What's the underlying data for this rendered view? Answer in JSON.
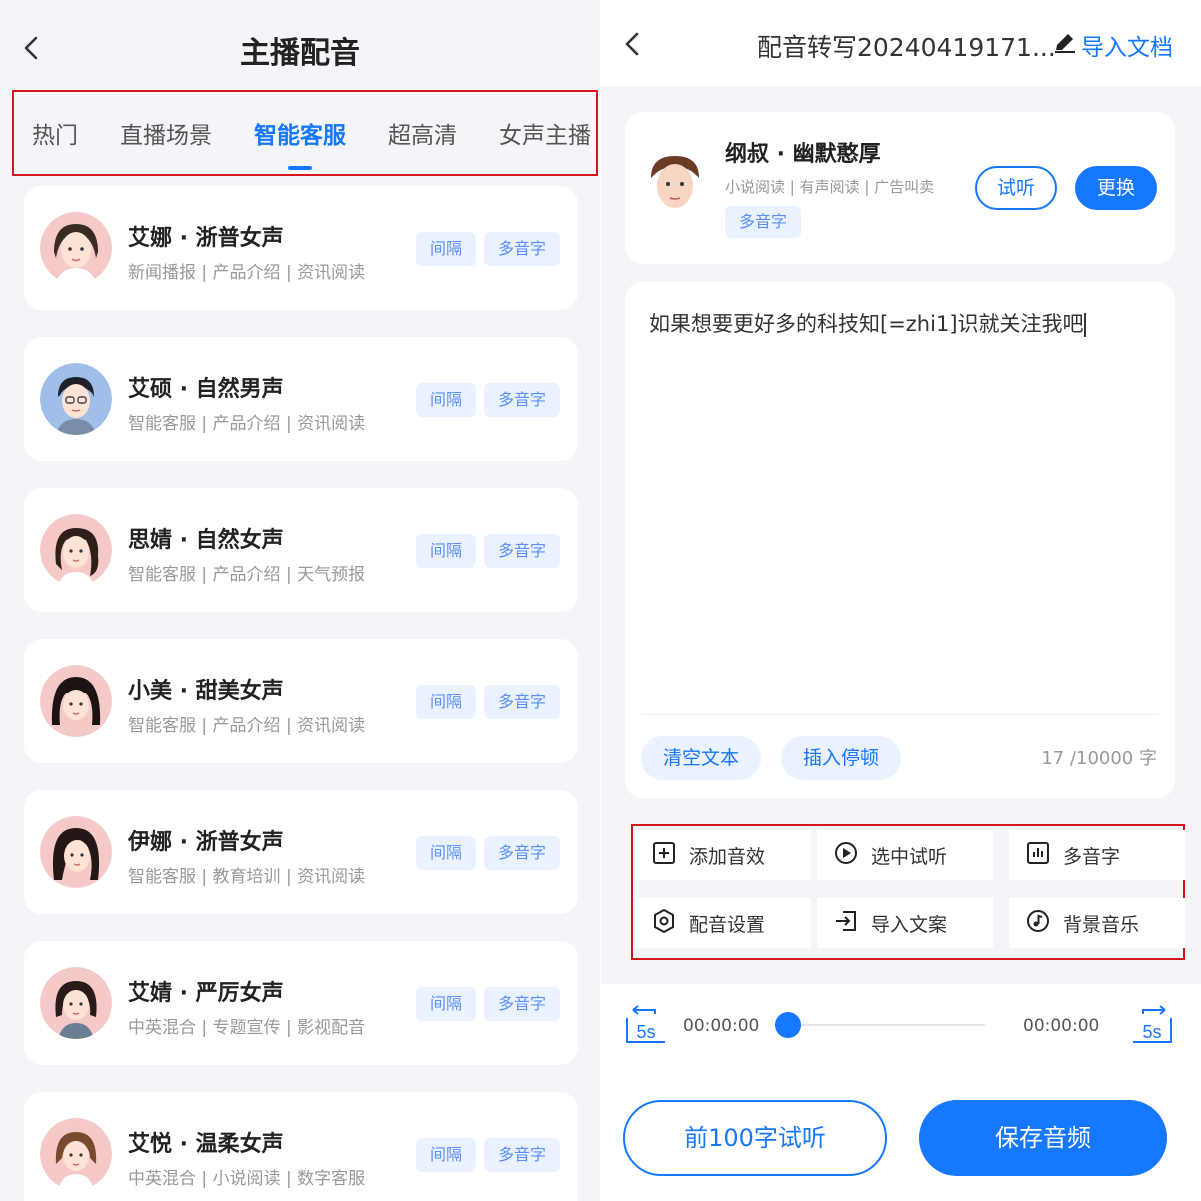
{
  "left": {
    "title": "主播配音",
    "tabs": [
      {
        "label": "热门",
        "active": false
      },
      {
        "label": "直播场景",
        "active": false
      },
      {
        "label": "智能客服",
        "active": true
      },
      {
        "label": "超高清",
        "active": false
      },
      {
        "label": "女声主播",
        "active": false
      }
    ],
    "voices": [
      {
        "name": "艾娜 · 浙普女声",
        "tags": "新闻播报 | 产品介绍 | 资讯阅读",
        "chip1": "间隔",
        "chip2": "多音字"
      },
      {
        "name": "艾硕 · 自然男声",
        "tags": "智能客服 | 产品介绍 | 资讯阅读",
        "chip1": "间隔",
        "chip2": "多音字"
      },
      {
        "name": "思婧 · 自然女声",
        "tags": "智能客服 | 产品介绍 | 天气预报",
        "chip1": "间隔",
        "chip2": "多音字"
      },
      {
        "name": "小美 · 甜美女声",
        "tags": "智能客服 | 产品介绍 | 资讯阅读",
        "chip1": "间隔",
        "chip2": "多音字"
      },
      {
        "name": "伊娜 · 浙普女声",
        "tags": "智能客服 | 教育培训 | 资讯阅读",
        "chip1": "间隔",
        "chip2": "多音字"
      },
      {
        "name": "艾婧 · 严厉女声",
        "tags": "中英混合 | 专题宣传 | 影视配音",
        "chip1": "间隔",
        "chip2": "多音字"
      },
      {
        "name": "艾悦 · 温柔女声",
        "tags": "中英混合 | 小说阅读 | 数字客服",
        "chip1": "间隔",
        "chip2": "多音字"
      }
    ]
  },
  "right": {
    "title": "配音转写20240419171...",
    "import_doc": "导入文档",
    "speaker": {
      "name": "纲叔 · 幽默憨厚",
      "tags": "小说阅读 | 有声阅读 | 广告叫卖",
      "chip": "多音字",
      "listen": "试听",
      "change": "更换"
    },
    "editor": {
      "text": "如果想要更好多的科技知[=zhi1]识就关注我吧",
      "clear": "清空文本",
      "insert_pause": "插入停顿",
      "count": "17 /10000 字"
    },
    "tools": [
      {
        "label": "添加音效",
        "icon": "add-square-icon"
      },
      {
        "label": "选中试听",
        "icon": "play-circle-icon"
      },
      {
        "label": "多音字",
        "icon": "bar-chart-icon"
      },
      {
        "label": "配音设置",
        "icon": "settings-icon"
      },
      {
        "label": "导入文案",
        "icon": "import-icon"
      },
      {
        "label": "背景音乐",
        "icon": "music-icon"
      }
    ],
    "player": {
      "skip_back": "5s",
      "skip_forward": "5s",
      "current_time": "00:00:00",
      "total_time": "00:00:00",
      "progress": 0
    },
    "preview_btn": "前100字试听",
    "save_btn": "保存音频"
  },
  "colors": {
    "accent": "#1677ff",
    "highlight_border": "#d4161c",
    "chip_bg": "#eaf2ff"
  }
}
